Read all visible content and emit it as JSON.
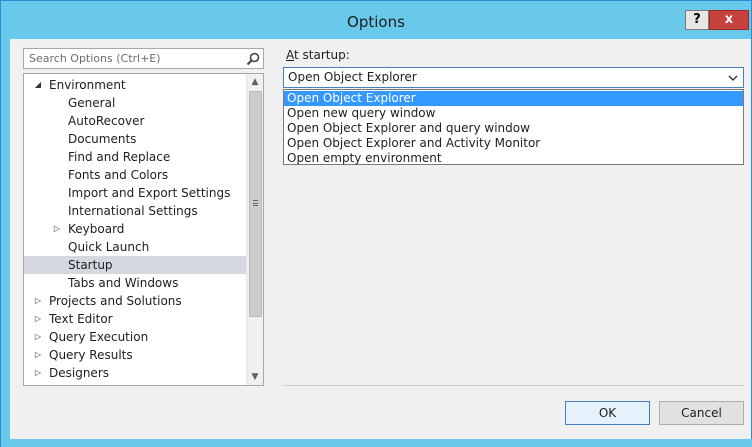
{
  "window": {
    "title": "Options",
    "help_label": "?",
    "close_label": "x"
  },
  "search": {
    "placeholder": "Search Options (Ctrl+E)"
  },
  "tree": {
    "items": [
      {
        "label": "Environment",
        "arrow": "◢"
      },
      {
        "label": "General"
      },
      {
        "label": "AutoRecover"
      },
      {
        "label": "Documents"
      },
      {
        "label": "Find and Replace"
      },
      {
        "label": "Fonts and Colors"
      },
      {
        "label": "Import and Export Settings"
      },
      {
        "label": "International Settings"
      },
      {
        "label": "Keyboard",
        "arrow": "▷"
      },
      {
        "label": "Quick Launch"
      },
      {
        "label": "Startup"
      },
      {
        "label": "Tabs and Windows"
      },
      {
        "label": "Projects and Solutions",
        "arrow": "▷"
      },
      {
        "label": "Text Editor",
        "arrow": "▷"
      },
      {
        "label": "Query Execution",
        "arrow": "▷"
      },
      {
        "label": "Query Results",
        "arrow": "▷"
      },
      {
        "label": "Designers",
        "arrow": "▷"
      }
    ],
    "selected": "Startup"
  },
  "startup": {
    "label_accel": "A",
    "label_rest": "t startup:",
    "selected_value": "Open Object Explorer",
    "options": [
      "Open Object Explorer",
      "Open new query window",
      "Open Object Explorer and query window",
      "Open Object Explorer and Activity Monitor",
      "Open empty environment"
    ]
  },
  "buttons": {
    "ok": "OK",
    "cancel": "Cancel"
  },
  "colors": {
    "titlebar": "#69c9ea",
    "close": "#c7413d",
    "highlight": "#3399ff",
    "tree_selected": "#d6d8e0"
  }
}
